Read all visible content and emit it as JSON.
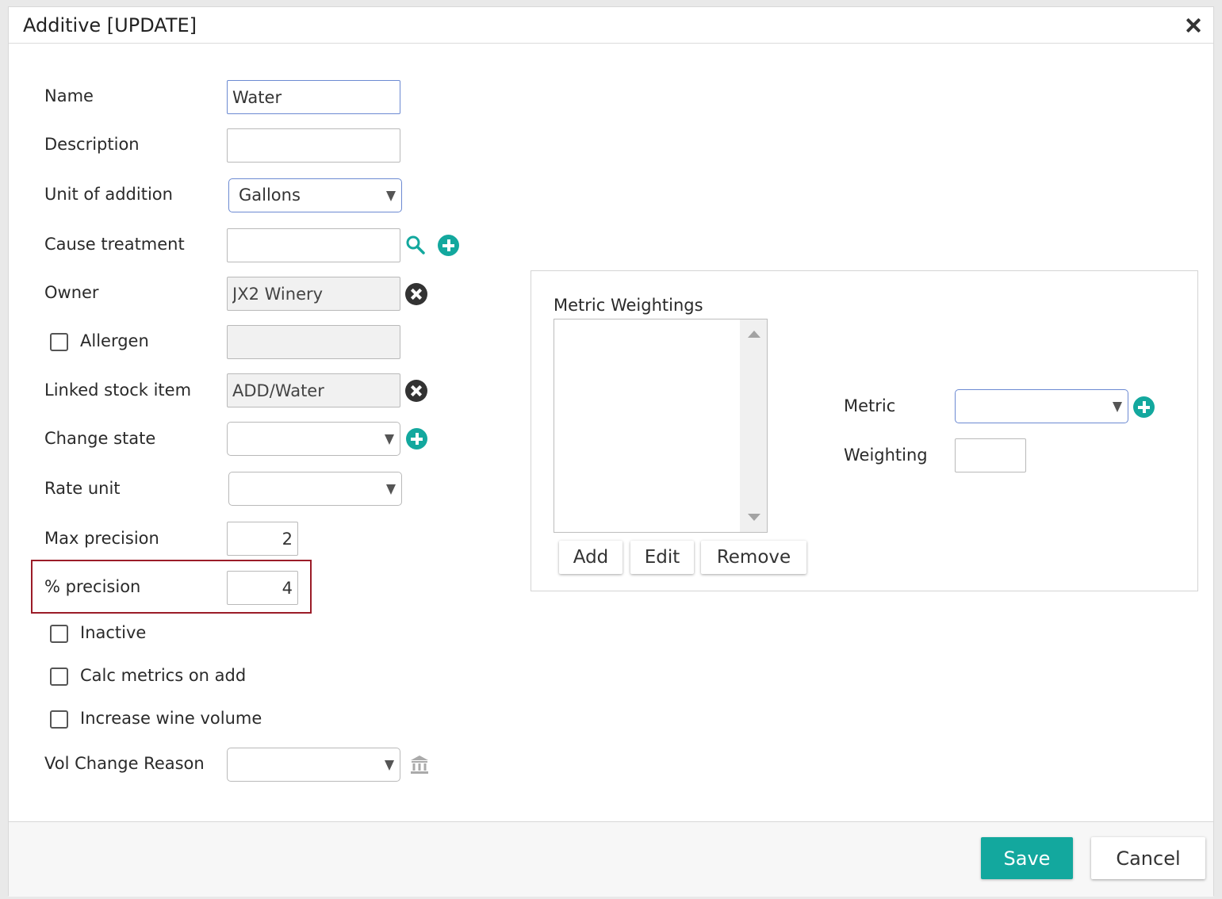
{
  "dialog": {
    "title": "Additive [UPDATE]",
    "close_icon": "close-icon"
  },
  "form": {
    "name": {
      "label": "Name",
      "value": "Water"
    },
    "description": {
      "label": "Description",
      "value": ""
    },
    "unit_of_addition": {
      "label": "Unit of addition",
      "value": "Gallons"
    },
    "cause_treatment": {
      "label": "Cause treatment",
      "value": "",
      "icons": [
        "search-icon",
        "add-icon"
      ]
    },
    "owner": {
      "label": "Owner",
      "value": "JX2 Winery",
      "icon": "clear-icon"
    },
    "allergen": {
      "label": "Allergen",
      "checked": false,
      "value": ""
    },
    "linked_stock_item": {
      "label": "Linked stock item",
      "value": "ADD/Water",
      "icon": "clear-icon"
    },
    "change_state": {
      "label": "Change state",
      "value": "",
      "icon": "add-icon"
    },
    "rate_unit": {
      "label": "Rate unit",
      "value": ""
    },
    "max_precision": {
      "label": "Max precision",
      "value": "2"
    },
    "pct_precision": {
      "label": "% precision",
      "value": "4"
    },
    "inactive": {
      "label": "Inactive",
      "checked": false
    },
    "calc_metrics_on_add": {
      "label": "Calc metrics on add",
      "checked": false
    },
    "increase_wine_volume": {
      "label": "Increase wine volume",
      "checked": false
    },
    "vol_change_reason": {
      "label": "Vol Change Reason",
      "value": "",
      "icon": "bank-icon"
    }
  },
  "metric_weightings": {
    "title": "Metric Weightings",
    "items": [],
    "buttons": {
      "add": "Add",
      "edit": "Edit",
      "remove": "Remove"
    },
    "metric": {
      "label": "Metric",
      "value": ""
    },
    "weighting": {
      "label": "Weighting",
      "value": ""
    }
  },
  "footer": {
    "save": "Save",
    "cancel": "Cancel"
  },
  "colors": {
    "accent": "#13a89e",
    "highlight": "#9b1c28",
    "focus_border": "#6c8ad2"
  }
}
